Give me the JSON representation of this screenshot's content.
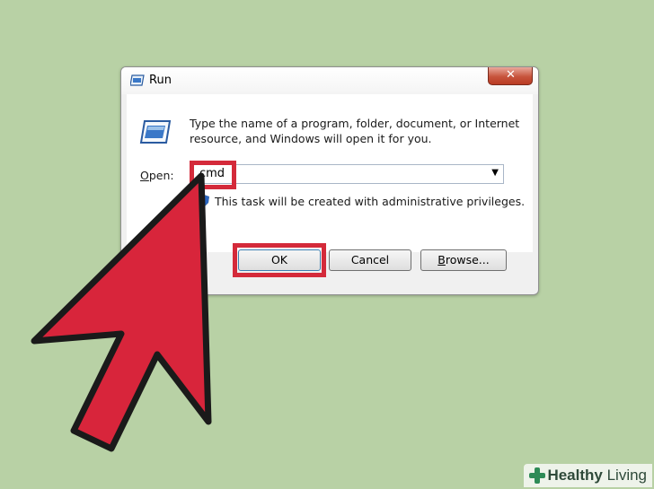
{
  "window": {
    "title": "Run",
    "close_label": "✕"
  },
  "description": {
    "line1": "Type the name of a program, folder, document, or Internet",
    "line2": "resource, and Windows will open it for you."
  },
  "open_field": {
    "label_accel": "O",
    "label_rest": "pen:",
    "value": "cmd"
  },
  "admin_note": "This task will be created with administrative privileges.",
  "buttons": {
    "ok": "OK",
    "cancel": "Cancel",
    "browse_accel": "B",
    "browse_rest": "rowse..."
  },
  "watermark": {
    "bold": "Healthy",
    "normal": " Living"
  },
  "colors": {
    "background": "#b8d1a5",
    "highlight_red": "#d42a3a",
    "arrow_red": "#d8253b"
  },
  "icons": {
    "title": "run-icon",
    "main": "run-program-icon",
    "shield": "uac-shield-icon",
    "dropdown": "chevron-down-icon",
    "pointer": "big-red-arrow-icon"
  }
}
